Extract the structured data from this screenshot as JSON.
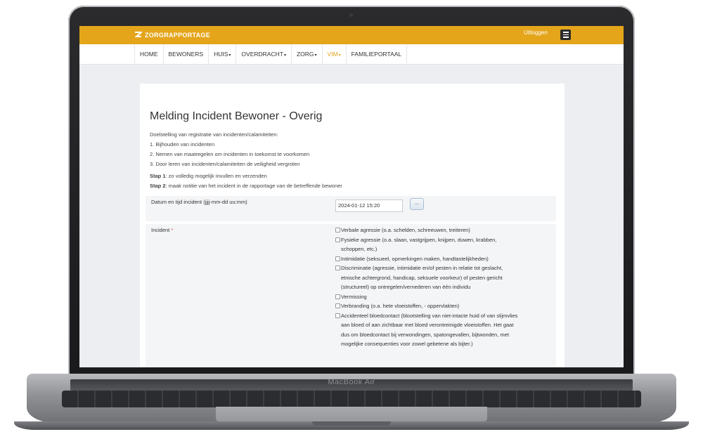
{
  "device": {
    "model_label": "MacBook Air"
  },
  "app": {
    "brand": "ZORGRAPPORTAGE",
    "logout_label": "Uitloggen"
  },
  "nav": {
    "items": [
      {
        "label": "HOME",
        "caret": false
      },
      {
        "label": "BEWONERS",
        "caret": false
      },
      {
        "label": "HUIS",
        "caret": true
      },
      {
        "label": "OVERDRACHT",
        "caret": true
      },
      {
        "label": "ZORG",
        "caret": true
      },
      {
        "label": "VIM",
        "caret": true,
        "active": true
      },
      {
        "label": "FAMILIEPORTAAL",
        "caret": false
      }
    ]
  },
  "form": {
    "title": "Melding Incident Bewoner - Overig",
    "intro": [
      "Doelstelling van registratie van incidenten/calamiteiten:",
      "1. Bijhouden van incidenten",
      "2. Nemen van maatregelen om incidenten in toekomst te voorkomen",
      "3. Door leren van incidenten/calamiteiten de veiligheid vergroten"
    ],
    "steps": [
      {
        "label": "Stap 1",
        "text": ": zo volledig mogelijk invullen en verzenden"
      },
      {
        "label": "Stap 2",
        "text": ": maak notitie van het incident in de rapportage van de betreffende bewoner"
      }
    ],
    "date_field": {
      "label": "Datum en tijd incident (jjjj-mm-dd uu:mm)",
      "value": "2024-01-12 15:20",
      "button_label": "..."
    },
    "incident_field": {
      "label": "Incident",
      "required_marker": "*",
      "options": [
        "Verbale agressie (o.a. schelden, schreeuwen, treiteren)",
        "Fysieke agressie (o.a. slaan, vastgrijpen, knijpen, duwen, krabben, schoppen, etc.)",
        "Intimidatie (seksueel, opmerkingen maken, handtastelijkheden)",
        "Discriminatie (agressie, intimidatie en/of pesten in relatie tot geslacht, etnische achtergrond, handicap, seksuele voorkeur) of pesten gericht (structureel) op ontregelen/vernederen van één individu",
        "Vermissing",
        "Verbranding (o.a. hete vloeistoffen, - oppervlakten)",
        "Accidenteel bloedcontact (blootstelling van niet-intacte huid of van slijmvlies aan bloed of aan zichtbaar met bloed verontreinigde vloeistoffen. Het gaat dus om bloedcontact bij verwondingen, spatongevallen, bijtwonden, met mogelijke consequenties voor zowel gebetene als bijter.)"
      ]
    }
  },
  "colors": {
    "accent": "#e4a51b",
    "page_bg": "#eceef1",
    "required": "#d9534f"
  }
}
